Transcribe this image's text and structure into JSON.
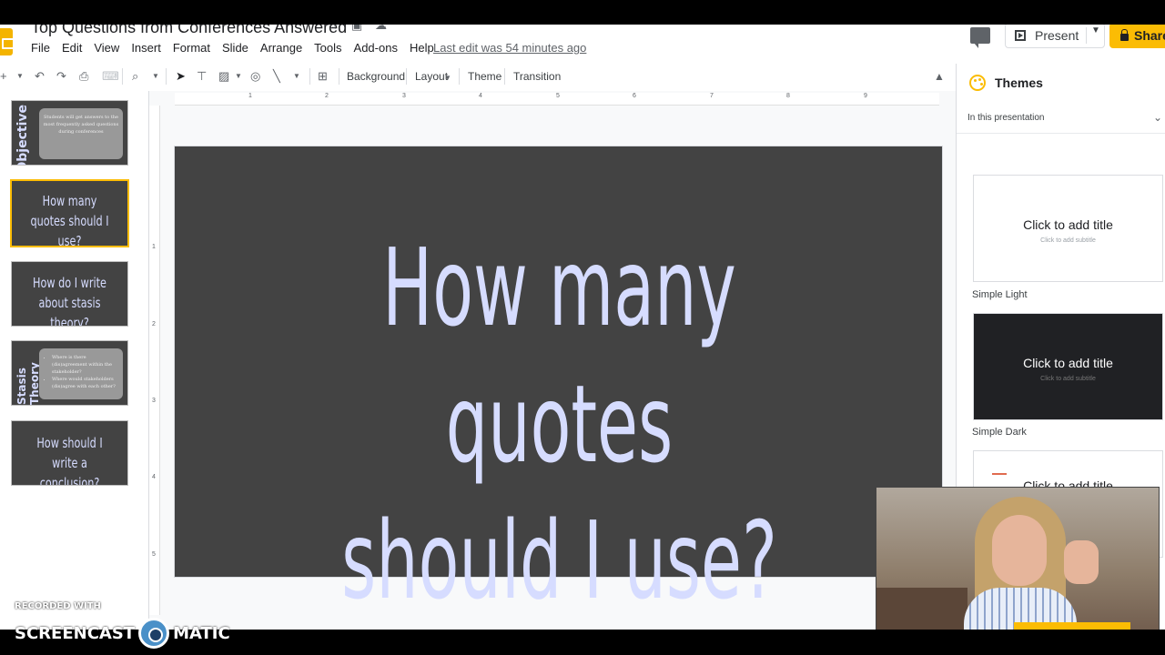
{
  "header": {
    "doc_title": "Top Questions from Conferences Answered",
    "menu": [
      "File",
      "Edit",
      "View",
      "Insert",
      "Format",
      "Slide",
      "Arrange",
      "Tools",
      "Add-ons",
      "Help"
    ],
    "last_edit": "Last edit was 54 minutes ago",
    "present_label": "Present",
    "share_label": "Share"
  },
  "toolbar": {
    "background": "Background",
    "layout": "Layout",
    "theme": "Theme",
    "transition": "Transition"
  },
  "filmstrip": {
    "slide1_title": "Objective",
    "slide1_body": "Students will get answers to the most frequently asked questions during conferences",
    "slide2_title": "How many quotes should I use?",
    "slide3_title": "How do I write about stasis theory?",
    "slide4_title": "Stasis Theory",
    "slide4_bullets": [
      "Where is there (dis)agreement within the stakeholder?",
      "Where would stakeholders (dis)agree with each other?"
    ],
    "slide5_title": "How should I write a conclusion?"
  },
  "ruler": {
    "h": [
      "1",
      "2",
      "3",
      "4",
      "5",
      "6",
      "7",
      "8",
      "9"
    ],
    "v": [
      "1",
      "2",
      "3",
      "4",
      "5"
    ]
  },
  "slide": {
    "title_line1": "How many quotes",
    "title_line2": "should I use?"
  },
  "themes": {
    "heading": "Themes",
    "section": "In this presentation",
    "cards": [
      {
        "title": "Click to add title",
        "subtitle": "Click to add subtitle",
        "name": "Simple Light"
      },
      {
        "title": "Click to add title",
        "subtitle": "Click to add subtitle",
        "name": "Simple Dark"
      },
      {
        "title": "Click to add title"
      }
    ]
  },
  "watermark": {
    "top": "RECORDED WITH",
    "left": "SCREENCAST",
    "right": "MATIC"
  },
  "colors": {
    "accent": "#fbbc04",
    "slide_bg": "#434343",
    "slide_text": "#d6dcff"
  }
}
